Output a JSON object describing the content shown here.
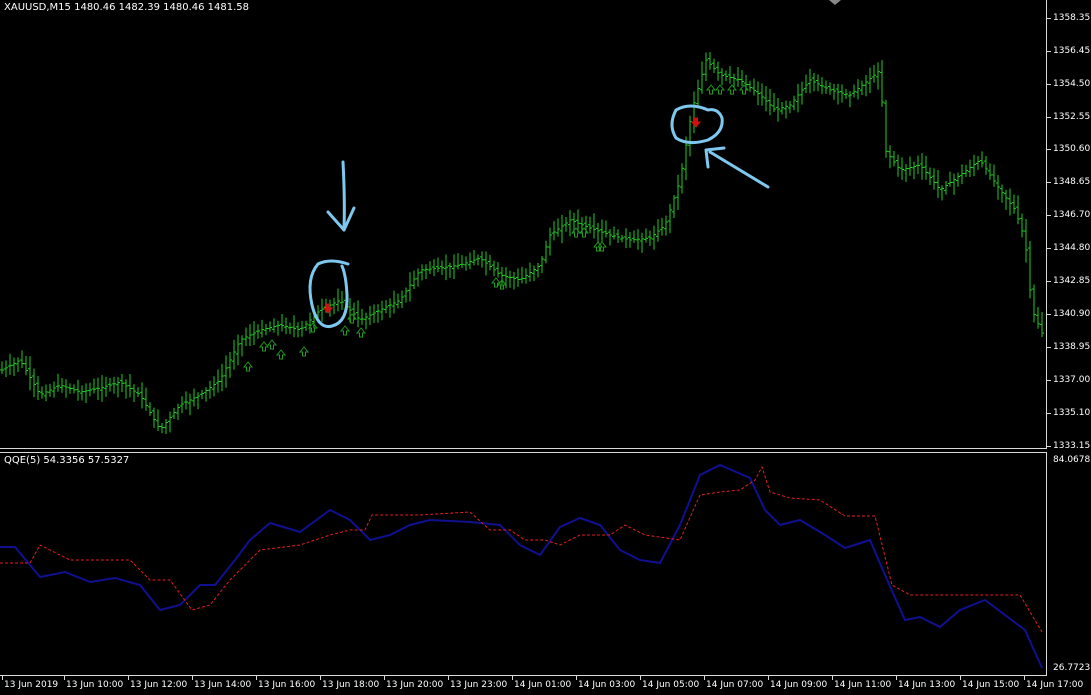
{
  "main_chart": {
    "title": "XAUUSD,M15  1480.46 1482.39 1480.46 1481.58",
    "price_ticks": [
      "1358.35",
      "1356.45",
      "1354.50",
      "1352.55",
      "1350.60",
      "1348.65",
      "1346.70",
      "1344.80",
      "1342.85",
      "1340.90",
      "1338.95",
      "1337.00",
      "1335.10",
      "1333.15"
    ]
  },
  "indicator": {
    "title": "QQE(5) 54.3356 57.5327",
    "max_label": "84.0678",
    "min_label": "26.7723"
  },
  "time_ticks": [
    "13 Jun 2019",
    "13 Jun 10:00",
    "13 Jun 12:00",
    "13 Jun 14:00",
    "13 Jun 16:00",
    "13 Jun 18:00",
    "13 Jun 20:00",
    "13 Jun 23:00",
    "14 Jun 01:00",
    "14 Jun 03:00",
    "14 Jun 05:00",
    "14 Jun 07:00",
    "14 Jun 09:00",
    "14 Jun 11:00",
    "14 Jun 13:00",
    "14 Jun 15:00",
    "14 Jun 17:00"
  ],
  "colors": {
    "bar": "#22cc22",
    "up_arrow": "#1f9a1f",
    "down_arrow": "#d21010",
    "qqe_line": "#101090",
    "signal_line": "#e02020",
    "annotation": "#7ec8f0"
  }
}
